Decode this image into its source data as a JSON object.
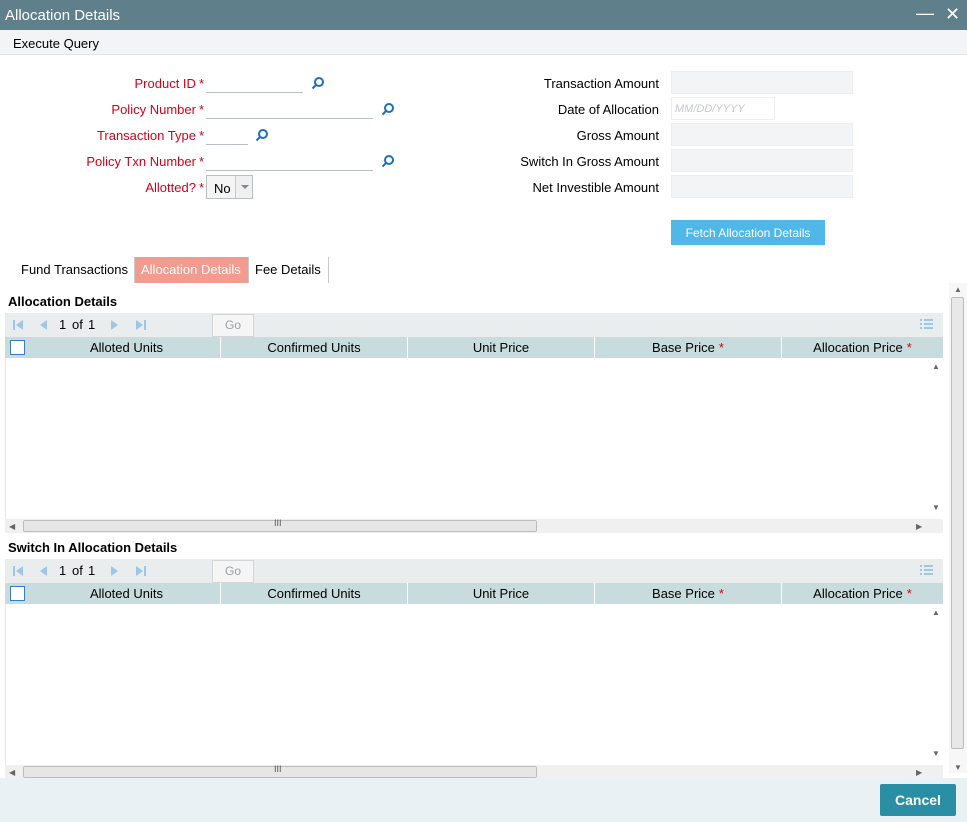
{
  "window": {
    "title": "Allocation Details"
  },
  "menu": {
    "execute_query": "Execute Query"
  },
  "left_fields": [
    {
      "label": "Product ID",
      "value": ""
    },
    {
      "label": "Policy Number",
      "value": ""
    },
    {
      "label": "Transaction Type",
      "value": ""
    },
    {
      "label": "Policy Txn Number",
      "value": ""
    },
    {
      "label": "Allotted?",
      "value": "No"
    }
  ],
  "required_mark": "*",
  "right_fields": [
    {
      "label": "Transaction Amount",
      "value": ""
    },
    {
      "label": "Date of Allocation",
      "placeholder": "MM/DD/YYYY"
    },
    {
      "label": "Gross Amount",
      "value": ""
    },
    {
      "label": "Switch In Gross Amount",
      "value": ""
    },
    {
      "label": "Net Investible Amount",
      "value": ""
    }
  ],
  "fetch_button": "Fetch Allocation Details",
  "tabs": [
    {
      "label": "Fund Transactions",
      "active": false
    },
    {
      "label": "Allocation Details",
      "active": true
    },
    {
      "label": "Fee Details",
      "active": false
    }
  ],
  "grids": [
    {
      "title": "Allocation Details",
      "page_current": "1",
      "page_of": "of",
      "page_total": "1",
      "go_label": "Go",
      "columns": [
        "Alloted Units",
        "Confirmed Units",
        "Unit Price",
        "Base Price",
        "Allocation Price"
      ]
    },
    {
      "title": "Switch In Allocation Details",
      "page_current": "1",
      "page_of": "of",
      "page_total": "1",
      "go_label": "Go",
      "columns": [
        "Alloted Units",
        "Confirmed Units",
        "Unit Price",
        "Base Price",
        "Allocation Price"
      ]
    }
  ],
  "cancel_button": "Cancel",
  "colors": {
    "titlebar": "#5f7f8a",
    "required": "#d0021b",
    "tab_active": "#f39b8e",
    "primary_button": "#2a8ea4",
    "fetch_button": "#4fb8e8",
    "grid_header": "#c8dcdd"
  }
}
